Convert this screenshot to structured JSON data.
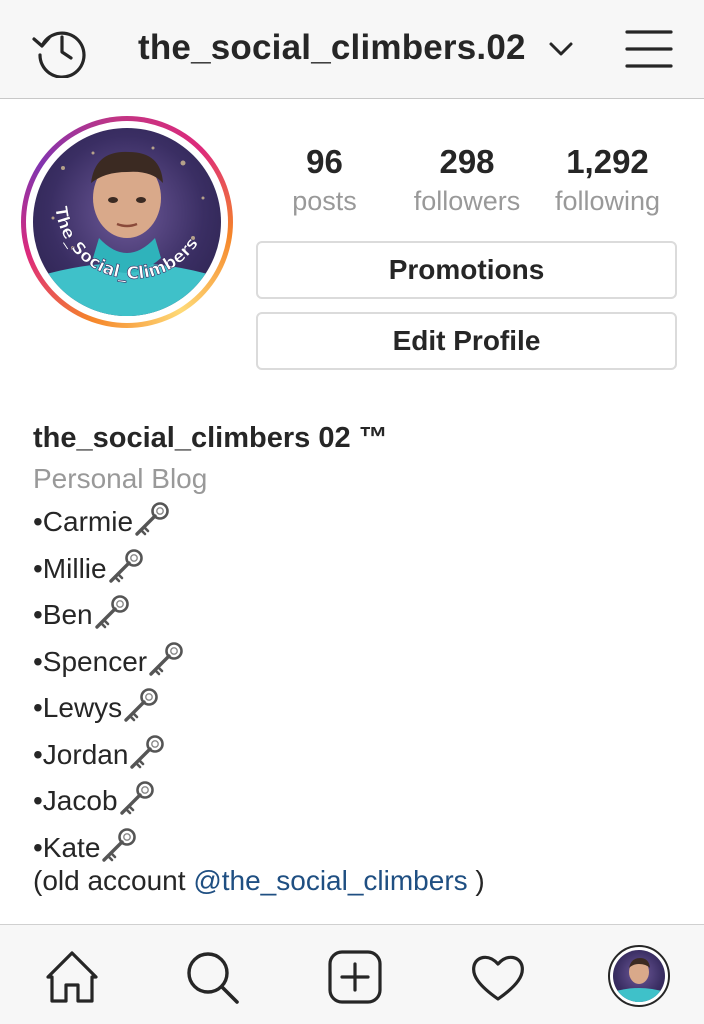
{
  "header": {
    "username": "the_social_climbers.02",
    "history_icon": "history-icon",
    "dropdown_icon": "chevron-down-icon",
    "menu_icon": "hamburger-menu-icon"
  },
  "profile": {
    "avatar_text": "The_Social_Climbers",
    "stats": [
      {
        "value": "96",
        "label": "posts"
      },
      {
        "value": "298",
        "label": "followers"
      },
      {
        "value": "1,292",
        "label": "following"
      }
    ],
    "buttons": {
      "promotions": "Promotions",
      "edit_profile": "Edit Profile"
    }
  },
  "bio": {
    "name": "the_social_climbers 02 ™",
    "category": "Personal Blog",
    "members": [
      "•Carmie",
      "•Millie",
      "•Ben",
      "•Spencer",
      "•Lewys",
      "•Jordan",
      "•Jacob",
      "•Kate"
    ],
    "member_icon": "old-key-icon",
    "old_account_prefix": "(old account ",
    "old_account_mention": "@the_social_climbers",
    "old_account_suffix": " )"
  },
  "tabbar": {
    "items": [
      "home-icon",
      "search-icon",
      "new-post-icon",
      "heart-icon",
      "profile-avatar"
    ]
  },
  "colors": {
    "text": "#262626",
    "secondary": "#999999",
    "link": "#1f4f82",
    "border": "#dbdbdb"
  }
}
